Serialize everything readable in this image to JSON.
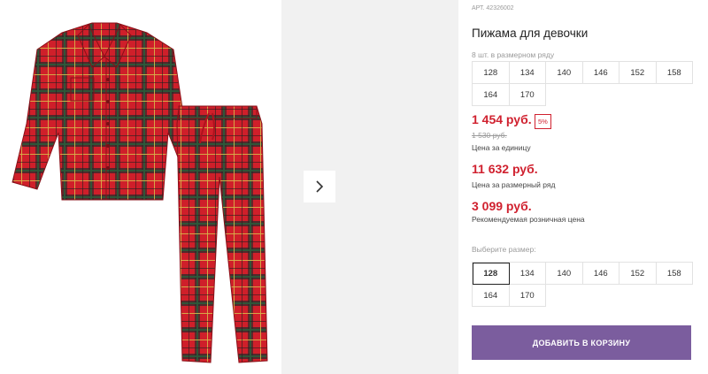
{
  "gallery": {
    "next_icon": "chevron-right-icon",
    "colors": {
      "red": "#cf1f2a",
      "dark": "#1f1f1f",
      "green": "#2c5a3a",
      "yellow": "#d8b54a"
    }
  },
  "product": {
    "article": "АРТ. 42326002",
    "title": "Пижама для девочки",
    "pack_note": "8 шт. в размерном ряду",
    "size_row": [
      "128",
      "134",
      "140",
      "146",
      "152",
      "158",
      "164",
      "170"
    ],
    "price": "1 454 руб.",
    "discount": "5%",
    "old_price": "1 530 руб.",
    "price_label": "Цена за единицу",
    "row_price": "11 632 руб.",
    "row_price_label": "Цена за размерный ряд",
    "retail_price": "3 099 руб.",
    "retail_price_label": "Рекомендуемая розничная цена",
    "choose_size_label": "Выберите размер:",
    "sizes": [
      "128",
      "134",
      "140",
      "146",
      "152",
      "158",
      "164",
      "170"
    ],
    "selected_size": "128",
    "add_to_cart": "ДОБАВИТЬ В КОРЗИНУ",
    "accent_color": "#d0212f",
    "button_color": "#7b5d9e"
  }
}
